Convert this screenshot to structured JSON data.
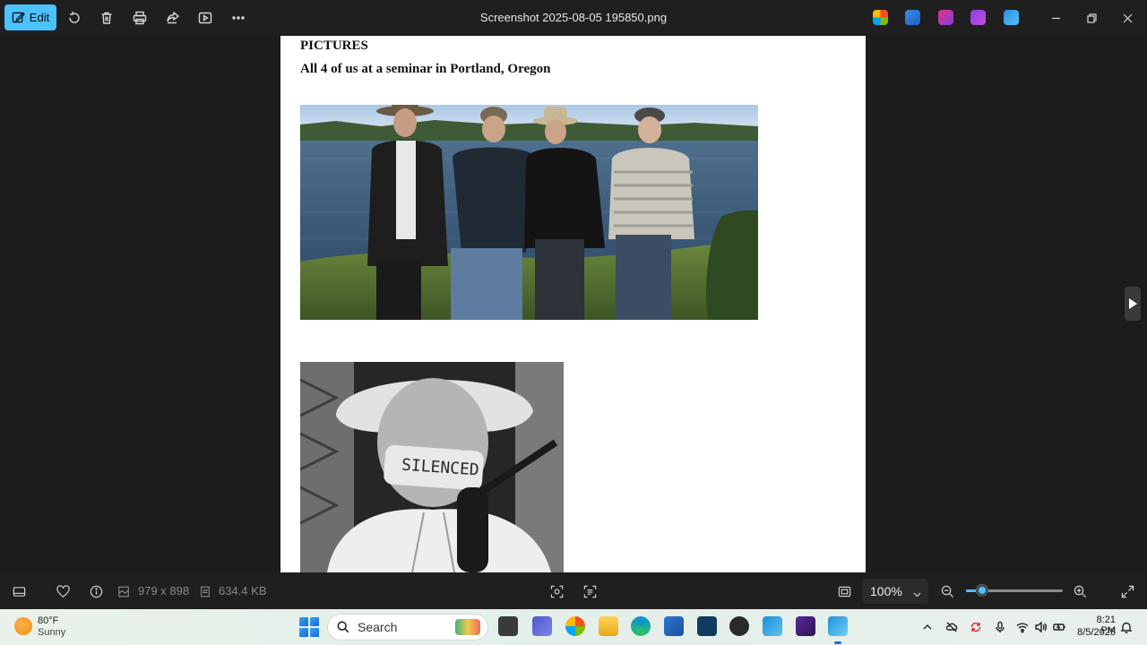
{
  "toolbar": {
    "edit_label": "Edit",
    "title": "Screenshot 2025-08-05 195850.png",
    "icons": [
      "rotate-icon",
      "delete-icon",
      "print-icon",
      "share-icon",
      "slideshow-icon",
      "more-icon"
    ]
  },
  "document": {
    "heading": "PICTURES",
    "caption": "All 4 of us at a seminar in Portland, Oregon",
    "photo_banner_text": "SILENCED"
  },
  "statusbar": {
    "dimensions": "979 x 898",
    "file_size": "634.4 KB",
    "zoom": "100%",
    "zoom_slider_fraction": 0.17
  },
  "taskbar": {
    "weather_temp": "80°F",
    "weather_condition": "Sunny",
    "search_label": "Search",
    "time": "8:21 PM",
    "date": "8/5/2025"
  }
}
